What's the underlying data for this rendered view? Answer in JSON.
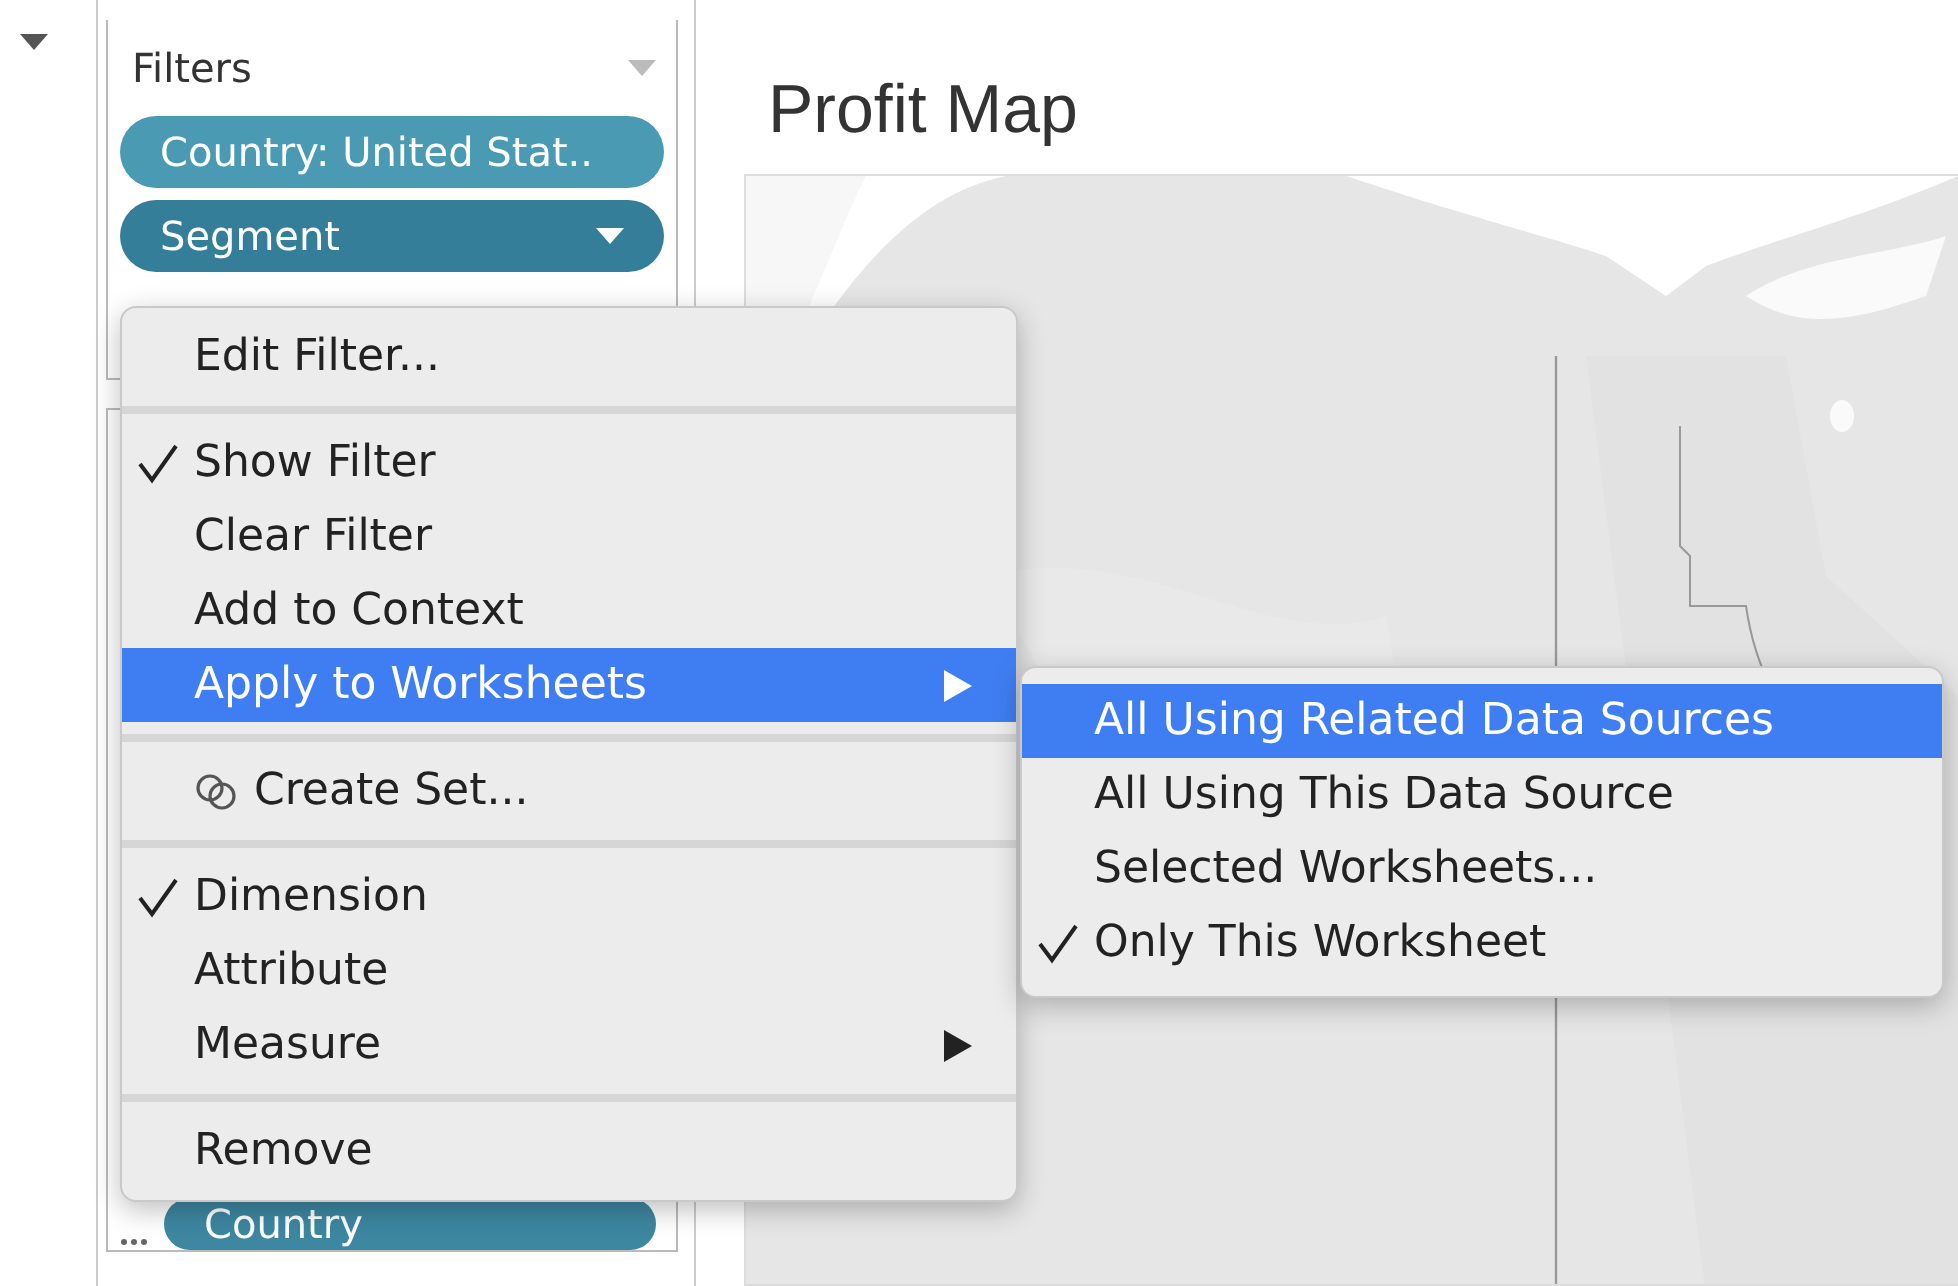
{
  "filters": {
    "title": "Filters",
    "pills": [
      {
        "label": "Country: United Stat..",
        "selected": false
      },
      {
        "label": "Segment",
        "selected": true
      }
    ]
  },
  "marks_pill": {
    "label": "Country"
  },
  "sheet": {
    "title": "Profit Map"
  },
  "context_menu": {
    "sections": [
      [
        {
          "label": "Edit Filter...",
          "kind": "item",
          "checked": false,
          "has_submenu": false,
          "selected": false
        }
      ],
      [
        {
          "label": "Show Filter",
          "kind": "item",
          "checked": true,
          "has_submenu": false,
          "selected": false
        },
        {
          "label": "Clear Filter",
          "kind": "item",
          "checked": false,
          "has_submenu": false,
          "selected": false
        },
        {
          "label": "Add to Context",
          "kind": "item",
          "checked": false,
          "has_submenu": false,
          "selected": false
        },
        {
          "label": "Apply to Worksheets",
          "kind": "item",
          "checked": false,
          "has_submenu": true,
          "selected": true
        }
      ],
      [
        {
          "label": "Create Set...",
          "kind": "set",
          "checked": false,
          "has_submenu": false,
          "selected": false
        }
      ],
      [
        {
          "label": "Dimension",
          "kind": "item",
          "checked": true,
          "has_submenu": false,
          "selected": false
        },
        {
          "label": "Attribute",
          "kind": "item",
          "checked": false,
          "has_submenu": false,
          "selected": false
        },
        {
          "label": "Measure",
          "kind": "item",
          "checked": false,
          "has_submenu": true,
          "selected": false
        }
      ],
      [
        {
          "label": "Remove",
          "kind": "item",
          "checked": false,
          "has_submenu": false,
          "selected": false
        }
      ]
    ]
  },
  "submenu": {
    "items": [
      {
        "label": "All Using Related Data Sources",
        "checked": false,
        "selected": true
      },
      {
        "label": "All Using This Data Source",
        "checked": false,
        "selected": false
      },
      {
        "label": "Selected Worksheets...",
        "checked": false,
        "selected": false
      },
      {
        "label": "Only This Worksheet",
        "checked": true,
        "selected": false
      }
    ]
  }
}
